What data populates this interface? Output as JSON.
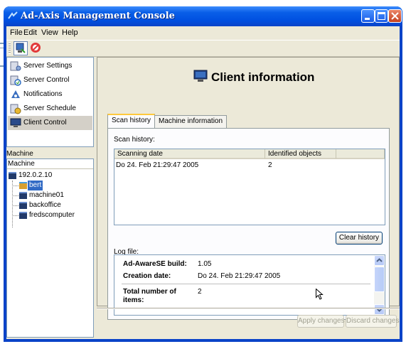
{
  "window": {
    "title": "Ad-Axis Management Console"
  },
  "menu": {
    "items": [
      {
        "label": "File"
      },
      {
        "label": "Edit"
      },
      {
        "label": "View"
      },
      {
        "label": "Help"
      }
    ]
  },
  "nav": {
    "items": [
      {
        "label": "Server Settings",
        "icon": "server-settings-icon"
      },
      {
        "label": "Server Control",
        "icon": "server-control-icon"
      },
      {
        "label": "Notifications",
        "icon": "notifications-icon"
      },
      {
        "label": "Server Schedule",
        "icon": "server-schedule-icon"
      },
      {
        "label": "Client Control",
        "icon": "monitor-icon"
      }
    ],
    "selected": "Client Control"
  },
  "machine_tree": {
    "section_label": "Machine",
    "header": "Machine",
    "root": "192.0.2.10",
    "children": [
      {
        "label": "bert",
        "selected": true
      },
      {
        "label": "machine01"
      },
      {
        "label": "backoffice"
      },
      {
        "label": "fredscomputer"
      }
    ]
  },
  "panel": {
    "title": "Client information",
    "tabs": [
      {
        "label": "Scan history",
        "active": true
      },
      {
        "label": "Machine information",
        "active": false
      }
    ],
    "scan_history": {
      "label": "Scan history:",
      "columns": [
        "Scanning date",
        "Identified objects"
      ],
      "rows": [
        {
          "date": "Do 24. Feb 21:29:47 2005",
          "objects": "2"
        }
      ],
      "clear_button": "Clear history"
    },
    "log": {
      "label": "Log file:",
      "entries": [
        {
          "key": "Ad-AwareSE build:",
          "value": "1.05"
        },
        {
          "key": "Creation date:",
          "value": "Do 24. Feb 21:29:47 2005"
        },
        {
          "key": "Total number of items:",
          "value": "2"
        }
      ]
    }
  },
  "footer": {
    "apply_button": "Apply changes",
    "discard_button": "Discard changes"
  },
  "colors": {
    "titlebar": "#0a5fe8",
    "window_bg": "#ece9d8",
    "selection": "#316ac5",
    "tab_highlight": "#ffc83c"
  }
}
